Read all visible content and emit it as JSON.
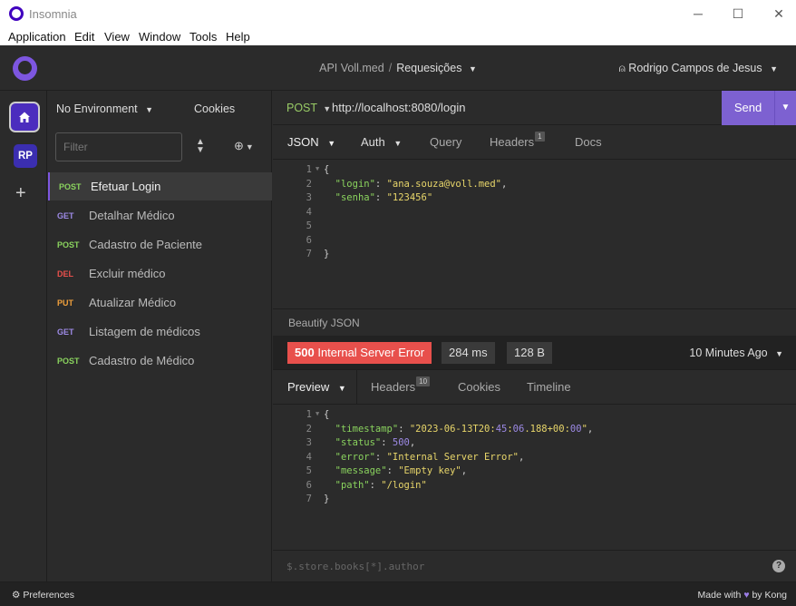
{
  "window": {
    "title": "Insomnia",
    "controls": [
      "─",
      "☐",
      "✕"
    ]
  },
  "menu": [
    "Application",
    "Edit",
    "View",
    "Window",
    "Tools",
    "Help"
  ],
  "header": {
    "project": "API Voll.med",
    "separator": "/",
    "collection": "Requesições",
    "user": "Rodrigo Campos de Jesus"
  },
  "iconbar": {
    "project_initials": "RP",
    "add_symbol": "+"
  },
  "sidebar": {
    "environment": "No Environment",
    "cookies": "Cookies",
    "filter_placeholder": "Filter",
    "requests": [
      {
        "method": "POST",
        "name": "Efetuar Login",
        "color": "#8ad35e",
        "active": true
      },
      {
        "method": "GET",
        "name": "Detalhar Médico",
        "color": "#9d8ae6"
      },
      {
        "method": "POST",
        "name": "Cadastro de Paciente",
        "color": "#8ad35e"
      },
      {
        "method": "DEL",
        "name": "Excluir médico",
        "color": "#e8504c"
      },
      {
        "method": "PUT",
        "name": "Atualizar Médico",
        "color": "#f0a03c"
      },
      {
        "method": "GET",
        "name": "Listagem de médicos",
        "color": "#9d8ae6"
      },
      {
        "method": "POST",
        "name": "Cadastro de Médico",
        "color": "#8ad35e"
      }
    ]
  },
  "request": {
    "method": "POST",
    "url": "http://localhost:8080/login",
    "send_label": "Send",
    "tabs": {
      "json": "JSON",
      "auth": "Auth",
      "query": "Query",
      "headers": "Headers",
      "headers_count": "1",
      "docs": "Docs"
    },
    "body_lines": [
      {
        "n": "1",
        "fold": true,
        "text": "{"
      },
      {
        "n": "2",
        "text": "  \"login\": \"ana.souza@voll.med\","
      },
      {
        "n": "3",
        "text": "  \"senha\": \"123456\""
      },
      {
        "n": "4",
        "text": ""
      },
      {
        "n": "5",
        "text": ""
      },
      {
        "n": "6",
        "text": ""
      },
      {
        "n": "7",
        "text": "}"
      }
    ],
    "beautify": "Beautify JSON"
  },
  "response": {
    "status_code": "500",
    "status_text": "Internal Server Error",
    "time": "284 ms",
    "size": "128 B",
    "ago": "10 Minutes Ago",
    "tabs": {
      "preview": "Preview",
      "headers": "Headers",
      "headers_count": "10",
      "cookies": "Cookies",
      "timeline": "Timeline"
    },
    "body_lines": [
      {
        "n": "1",
        "fold": true,
        "text": "{"
      },
      {
        "n": "2",
        "text": "  \"timestamp\": \"2023-06-13T20:45:06.188+00:00\","
      },
      {
        "n": "3",
        "text": "  \"status\": 500,"
      },
      {
        "n": "4",
        "text": "  \"error\": \"Internal Server Error\","
      },
      {
        "n": "5",
        "text": "  \"message\": \"Empty key\","
      },
      {
        "n": "6",
        "text": "  \"path\": \"/login\""
      },
      {
        "n": "7",
        "text": "}"
      }
    ],
    "filter_placeholder": "$.store.books[*].author"
  },
  "statusbar": {
    "preferences": "Preferences",
    "made_with": "Made with",
    "by": "by Kong"
  },
  "colors": {
    "accent": "#7d61d1",
    "error": "#e8504c",
    "key": "#8ad35e",
    "string": "#e8d66a",
    "number": "#9d8ae6"
  }
}
